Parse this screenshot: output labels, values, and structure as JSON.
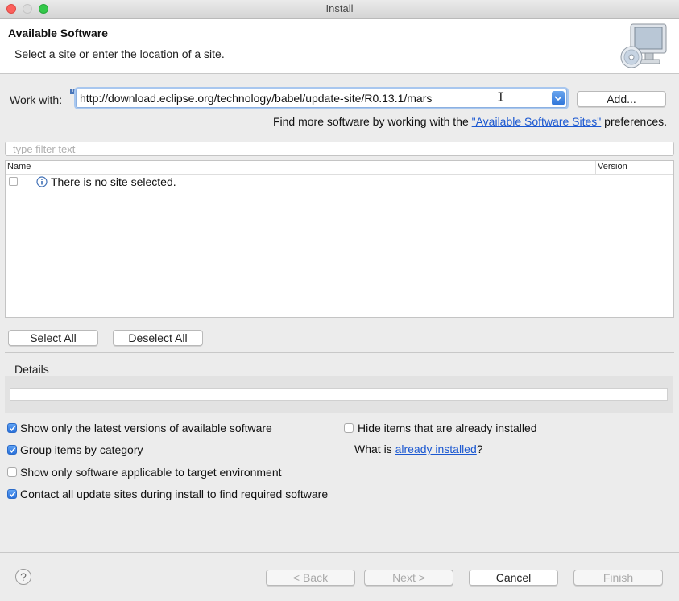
{
  "window": {
    "title": "Install"
  },
  "banner": {
    "title": "Available Software",
    "description": "Select a site or enter the location of a site."
  },
  "workwith": {
    "label": "Work with:",
    "value": "http://download.eclipse.org/technology/babel/update-site/R0.13.1/mars",
    "add_label": "Add..."
  },
  "findmore": {
    "prefix": "Find more software by working with the ",
    "link": "\"Available Software Sites\"",
    "suffix": " preferences."
  },
  "filter": {
    "placeholder": "type filter text"
  },
  "table": {
    "columns": [
      "Name",
      "Version"
    ],
    "rows": [
      {
        "text": "There is no site selected.",
        "checked": false
      }
    ]
  },
  "selection": {
    "select_all": "Select All",
    "deselect_all": "Deselect All"
  },
  "details": {
    "label": "Details",
    "value": ""
  },
  "options": {
    "latest_versions": {
      "label": "Show only the latest versions of available software",
      "checked": true
    },
    "group_by_category": {
      "label": "Group items by category",
      "checked": true
    },
    "target_env": {
      "label": "Show only software applicable to target environment",
      "checked": false
    },
    "contact_sites": {
      "label": "Contact all update sites during install to find required software",
      "checked": true
    },
    "hide_installed": {
      "label": "Hide items that are already installed",
      "checked": false
    },
    "what_is": {
      "prefix": "What is ",
      "link": "already installed",
      "suffix": "?"
    }
  },
  "footer": {
    "help": "?",
    "back": "< Back",
    "next": "Next >",
    "cancel": "Cancel",
    "finish": "Finish"
  },
  "colors": {
    "link": "#1b58d1",
    "accent": "#2b72db",
    "close": "#fc605c",
    "zoom": "#34c84a"
  }
}
